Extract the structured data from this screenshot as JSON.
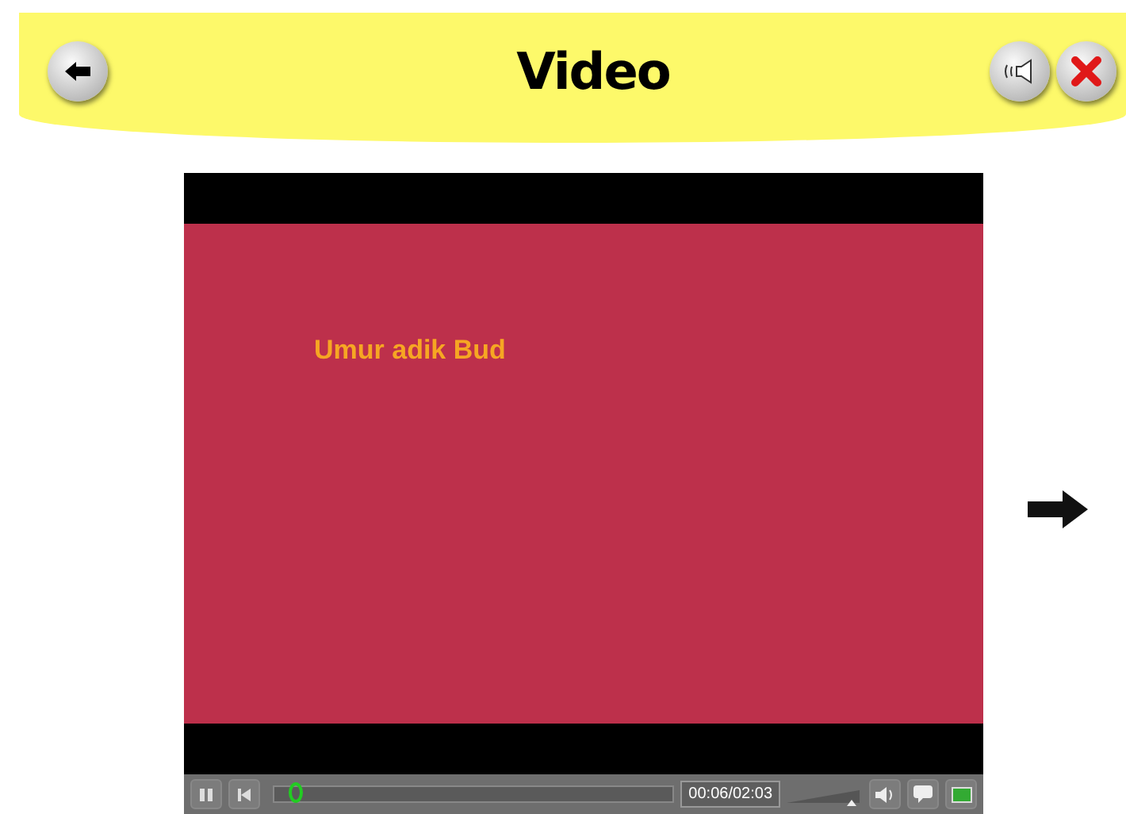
{
  "header": {
    "title": "Video"
  },
  "video": {
    "caption": "Umur adik Bud",
    "playing": true,
    "progress": {
      "level": 0.05
    },
    "time": "00:06/02:03",
    "volume": {
      "level": 0.9
    }
  }
}
